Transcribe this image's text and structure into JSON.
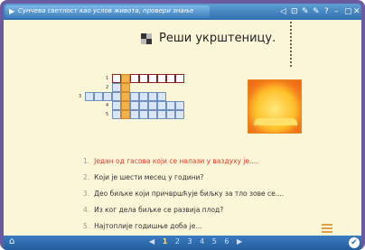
{
  "window": {
    "title": "Сунчева светлост као услов живота, провери знање",
    "tab_arrow": "▶",
    "toolbar_icons": [
      "send-icon",
      "fullscreen-icon",
      "pen-icon",
      "settings-icon",
      "help-icon",
      "minimize-icon",
      "maximize-icon",
      "close-icon"
    ],
    "toolbar_glyphs": [
      "◁",
      "⊡",
      "✎",
      "✎",
      "?",
      "–",
      "▢",
      "✕"
    ]
  },
  "heading": "Реши укрштеницу.",
  "crossword": {
    "row_numbers": [
      "1",
      "2",
      "3",
      "4",
      "5"
    ],
    "highlight_color": "#f2b24a",
    "cell_color": "#dbe6f5"
  },
  "clues": [
    {
      "num": "1.",
      "text": "Један од гасова који се налази у ваздуху је....",
      "active": true
    },
    {
      "num": "2.",
      "text": "Који је шести месец у години?",
      "active": false
    },
    {
      "num": "3.",
      "text": "Део биљке који причвршћује биљку за тло зове се....",
      "active": false
    },
    {
      "num": "4.",
      "text": "Из ког дела биљке се развија плод?",
      "active": false
    },
    {
      "num": "5.",
      "text": "Најтоплије годишње доба је...",
      "active": false
    }
  ],
  "bottom": {
    "home_glyph": "⌂",
    "prev_glyph": "◀",
    "next_glyph": "▶",
    "pages": [
      "1",
      "2",
      "3",
      "4",
      "5",
      "6"
    ],
    "current_page": "1",
    "check_glyph": "✔"
  },
  "colors": {
    "frame": "#6a5aa0",
    "titlebar": "#2f6fae",
    "content_bg": "#fbf6d8",
    "active_clue": "#e63a2a"
  }
}
